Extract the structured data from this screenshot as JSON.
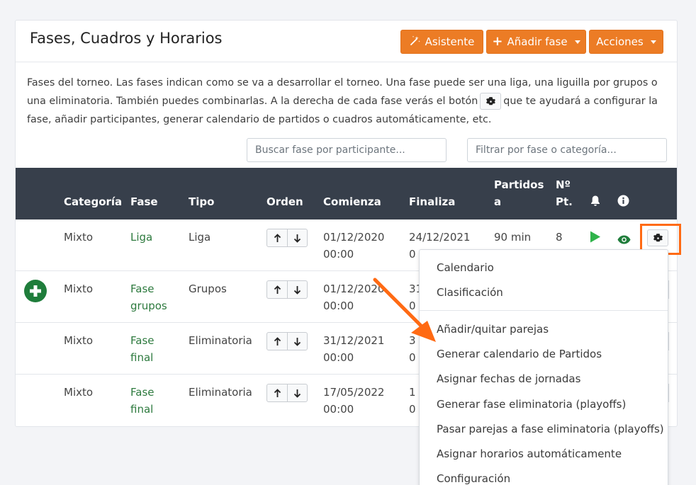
{
  "header": {
    "title": "Fases, Cuadros y Horarios",
    "wizard_label": "Asistente",
    "add_phase_label": "Añadir fase",
    "actions_label": "Acciones"
  },
  "description": {
    "part1": "Fases del torneo. Las fases indican como se va a desarrollar el torneo. Una fase puede ser una liga, una liguilla por grupos o una eliminatoria. También puedes combinarlas. A la derecha de cada fase verás el botón",
    "part2": "que te ayudará a configurar la fase, añadir participantes, generar calendario de partidos o cuadros automáticamente, etc."
  },
  "search": {
    "participant_placeholder": "Buscar fase por participante...",
    "filter_placeholder": "Filtrar por fase o categoría..."
  },
  "table": {
    "columns": {
      "categoria": "Categoría",
      "fase": "Fase",
      "tipo": "Tipo",
      "orden": "Orden",
      "comienza": "Comienza",
      "finaliza": "Finaliza",
      "partidos_l1": "Partidos",
      "partidos_l2": "a",
      "npt_l1": "Nº",
      "npt_l2": "Pt."
    },
    "rows": [
      {
        "categoria": "Mixto",
        "fase_l1": "Liga",
        "fase_l2": "",
        "tipo": "Liga",
        "comienza_l1": "01/12/2020",
        "comienza_l2": "00:00",
        "finaliza_l1": "24/12/2021",
        "finaliza_l2": "0",
        "partidos": "90 min",
        "npt": "8"
      },
      {
        "categoria": "Mixto",
        "fase_l1": "Fase",
        "fase_l2": "grupos",
        "tipo": "Grupos",
        "comienza_l1": "01/12/2020",
        "comienza_l2": "00:00",
        "finaliza_l1": "31",
        "finaliza_l2": "0"
      },
      {
        "categoria": "Mixto",
        "fase_l1": "Fase",
        "fase_l2": "final",
        "tipo": "Eliminatoria",
        "comienza_l1": "31/12/2021",
        "comienza_l2": "00:00",
        "finaliza_l1": "3",
        "finaliza_l2": "0"
      },
      {
        "categoria": "Mixto",
        "fase_l1": "Fase",
        "fase_l2": "final",
        "tipo": "Eliminatoria",
        "comienza_l1": "17/05/2022",
        "comienza_l2": "00:00",
        "finaliza_l1": "1",
        "finaliza_l2": "0"
      }
    ]
  },
  "dropdown": {
    "items": [
      "Calendario",
      "Clasificación",
      "Añadir/quitar parejas",
      "Generar calendario de Partidos",
      "Asignar fechas de jornadas",
      "Generar fase eliminatoria (playoffs)",
      "Pasar parejas a fase eliminatoria (playoffs)",
      "Asignar horarios automáticamente",
      "Configuración"
    ]
  },
  "colors": {
    "accent_orange": "#ec7c25",
    "highlight_orange": "#ff6a13",
    "header_dark": "#373f4b",
    "link_green": "#2d7a3e",
    "play_green": "#2fb34a"
  },
  "icons": [
    "magic-wand-icon",
    "plus-icon",
    "caret-down-icon",
    "gear-icon",
    "bell-icon",
    "info-icon",
    "arrow-up-icon",
    "arrow-down-icon",
    "play-icon",
    "eye-icon",
    "add-circle-icon",
    "pointer-arrow-icon"
  ]
}
